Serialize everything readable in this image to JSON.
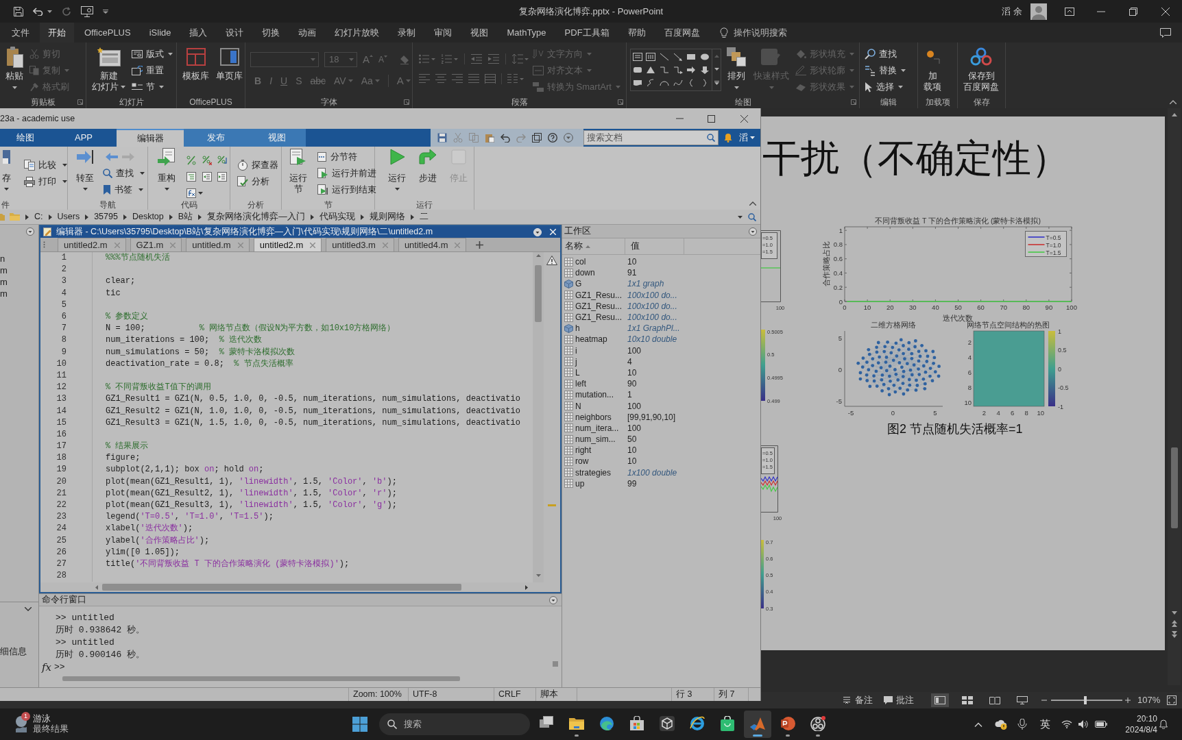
{
  "powerpoint": {
    "title": "复杂网络演化博弈.pptx - PowerPoint",
    "account": "滔 余",
    "menu_tabs": [
      {
        "label": "文件",
        "selected": false
      },
      {
        "label": "开始",
        "selected": true
      },
      {
        "label": "OfficePLUS",
        "selected": false
      },
      {
        "label": "iSlide",
        "selected": false
      },
      {
        "label": "插入",
        "selected": false
      },
      {
        "label": "设计",
        "selected": false
      },
      {
        "label": "切换",
        "selected": false
      },
      {
        "label": "动画",
        "selected": false
      },
      {
        "label": "幻灯片放映",
        "selected": false
      },
      {
        "label": "录制",
        "selected": false
      },
      {
        "label": "审阅",
        "selected": false
      },
      {
        "label": "视图",
        "selected": false
      },
      {
        "label": "MathType",
        "selected": false
      },
      {
        "label": "PDF工具箱",
        "selected": false
      },
      {
        "label": "帮助",
        "selected": false
      },
      {
        "label": "百度网盘",
        "selected": false
      }
    ],
    "tell_me": "操作说明搜索",
    "ribbon_groups": [
      {
        "label": "剪贴板",
        "launcher": true,
        "columns": [
          {
            "kind": "large",
            "lines": [
              "粘贴"
            ],
            "dropdown": true,
            "disabled": false
          },
          {
            "kind": "stack",
            "items": [
              {
                "label": "剪切",
                "dropdown": false,
                "disabled": true
              },
              {
                "label": "复制",
                "dropdown": true,
                "disabled": true
              },
              {
                "label": "格式刷",
                "dropdown": false,
                "disabled": true
              }
            ]
          }
        ]
      },
      {
        "label": "幻灯片",
        "launcher": false,
        "columns": [
          {
            "kind": "large",
            "lines": [
              "新建",
              "幻灯片"
            ],
            "dropdown": true,
            "disabled": false
          },
          {
            "kind": "stack",
            "items": [
              {
                "label": "版式",
                "dropdown": true,
                "disabled": false
              },
              {
                "label": "重置",
                "dropdown": false,
                "disabled": false
              },
              {
                "label": "节",
                "dropdown": true,
                "disabled": false
              }
            ]
          }
        ]
      },
      {
        "label": "OfficePLUS",
        "launcher": false,
        "columns": [
          {
            "kind": "large",
            "lines": [
              "模板库"
            ],
            "dropdown": false,
            "disabled": false
          },
          {
            "kind": "large",
            "lines": [
              "单页库"
            ],
            "dropdown": false,
            "disabled": false
          }
        ]
      },
      {
        "label": "字体",
        "launcher": true,
        "columns": [
          {
            "kind": "font",
            "size": "18",
            "grow": "A",
            "shrink": "A",
            "styles": [
              "B",
              "I",
              "U",
              "S",
              "abc",
              "AV",
              "Aa"
            ],
            "color_button": "A",
            "disabled": true
          }
        ]
      },
      {
        "label": "段落",
        "launcher": true,
        "columns": [
          {
            "kind": "paragraph",
            "disabled": true
          },
          {
            "kind": "stack",
            "items": [
              {
                "label": "文字方向",
                "dropdown": true,
                "disabled": true
              },
              {
                "label": "对齐文本",
                "dropdown": true,
                "disabled": true
              },
              {
                "label": "转换为 SmartArt",
                "dropdown": true,
                "disabled": true
              }
            ]
          }
        ]
      },
      {
        "label": "绘图",
        "launcher": true,
        "columns": [
          {
            "kind": "gallery"
          },
          {
            "kind": "large",
            "lines": [
              "排列"
            ],
            "dropdown": true,
            "disabled": false
          },
          {
            "kind": "large",
            "lines": [
              "快速样式"
            ],
            "dropdown": true,
            "disabled": true
          },
          {
            "kind": "stack",
            "items": [
              {
                "label": "形状填充",
                "dropdown": true,
                "disabled": true
              },
              {
                "label": "形状轮廓",
                "dropdown": true,
                "disabled": true
              },
              {
                "label": "形状效果",
                "dropdown": true,
                "disabled": true
              }
            ]
          }
        ]
      },
      {
        "label": "编辑",
        "launcher": false,
        "columns": [
          {
            "kind": "stack",
            "items": [
              {
                "label": "查找",
                "dropdown": false,
                "disabled": false
              },
              {
                "label": "替换",
                "dropdown": true,
                "disabled": false
              },
              {
                "label": "选择",
                "dropdown": true,
                "disabled": false
              }
            ]
          }
        ]
      },
      {
        "label": "加载项",
        "launcher": false,
        "columns": [
          {
            "kind": "large",
            "lines": [
              "加",
              "载项"
            ],
            "dropdown": false,
            "disabled": false
          }
        ]
      },
      {
        "label": "保存",
        "launcher": false,
        "columns": [
          {
            "kind": "large",
            "lines": [
              "保存到",
              "百度网盘"
            ],
            "dropdown": false,
            "disabled": false
          }
        ]
      }
    ],
    "slide": {
      "title": "干扰（不确定性）",
      "partial_figures": [
        {
          "kind": "flatplot",
          "legend": [
            "=0.5",
            "=1.0",
            "=1.5"
          ],
          "x_tick": "100"
        },
        {
          "kind": "colorbar",
          "ticks": [
            "0.5005",
            "0.5",
            "0.4995",
            "0.499"
          ]
        },
        {
          "kind": "wavyplot",
          "legend": [
            "=0.5",
            "=1.0",
            "=1.5"
          ],
          "x_tick": "100"
        },
        {
          "kind": "colorbar",
          "ticks": [
            "0.7",
            "0.6",
            "0.5",
            "0.4",
            "0.3"
          ]
        }
      ],
      "line_chart": {
        "chart_data": {
          "type": "line",
          "title": "不同背叛收益 T 下的合作策略演化 (蒙特卡洛模拟)",
          "xlabel": "迭代次数",
          "ylabel": "合作策略占比",
          "x": [
            1,
            100
          ],
          "series": [
            {
              "name": "T=0.5",
              "color": "#3232c8",
              "values": [
                null,
                null
              ]
            },
            {
              "name": "T=1.0",
              "color": "#c83232",
              "values": [
                null,
                null
              ]
            },
            {
              "name": "T=1.5",
              "color": "#46c846",
              "values": [
                0,
                0
              ]
            }
          ],
          "xlim": [
            0,
            100
          ],
          "ylim": [
            0,
            1.05
          ],
          "xticks": [
            0,
            10,
            20,
            30,
            40,
            50,
            60,
            70,
            80,
            90,
            100
          ],
          "yticks": [
            0,
            0.2,
            0.4,
            0.6,
            0.8,
            1
          ],
          "legend": "upper right"
        }
      },
      "network_plot": {
        "title": "二维方格网络",
        "yticks": [
          "5",
          "0",
          "-5"
        ],
        "xticks": [
          "-5",
          "0",
          "5"
        ]
      },
      "heatmap": {
        "title": "网络节点空间结构的热图",
        "yticks": [
          "2",
          "4",
          "6",
          "8",
          "10"
        ],
        "xticks": [
          "2",
          "4",
          "6",
          "8",
          "10"
        ],
        "colorbar_ticks": [
          "1",
          "0.5",
          "0",
          "-0.5",
          "-1"
        ]
      },
      "caption": "图2 节点随机失活概率=1"
    },
    "status_bar": {
      "notes": "备注",
      "comments": "批注",
      "views": [
        {
          "selected": true
        },
        {
          "selected": false
        },
        {
          "selected": false
        },
        {
          "selected": false
        }
      ],
      "zoom": {
        "level": 0.48,
        "reading": "107%"
      }
    }
  },
  "matlab": {
    "title": "23a - academic use",
    "tabs": [
      {
        "label": "绘图",
        "selected": false,
        "contextual": false
      },
      {
        "label": "APP",
        "selected": false,
        "contextual": false
      },
      {
        "label": "编辑器",
        "selected": true,
        "contextual": true
      },
      {
        "label": "发布",
        "selected": false,
        "contextual": true
      },
      {
        "label": "视图",
        "selected": false,
        "contextual": true
      }
    ],
    "search": {
      "placeholder": "搜索文档"
    },
    "account": "滔",
    "toolstrip": [
      {
        "label": "件",
        "columns": [
          {
            "kind": "large",
            "lines": [
              "存"
            ],
            "dropdown": true,
            "disabled": false
          },
          {
            "kind": "stack",
            "items": [
              {
                "kind": "button",
                "label": "比较",
                "dropdown": true,
                "disabled": false
              },
              {
                "kind": "button",
                "label": "打印",
                "dropdown": true,
                "disabled": false
              }
            ]
          }
        ]
      },
      {
        "label": "导航",
        "columns": [
          {
            "kind": "large",
            "lines": [
              "转至"
            ],
            "dropdown": true,
            "disabled": false
          },
          {
            "kind": "stack",
            "items": [
              {
                "kind": "arrows",
                "back_disabled": false,
                "forward_disabled": true
              },
              {
                "kind": "button",
                "label": "查找",
                "dropdown": true,
                "disabled": false
              },
              {
                "kind": "button",
                "label": "书签",
                "dropdown": true,
                "disabled": false
              }
            ]
          }
        ]
      },
      {
        "label": "代码",
        "columns": [
          {
            "kind": "large",
            "lines": [
              "重构"
            ],
            "dropdown": true,
            "disabled": false
          },
          {
            "kind": "icon_grid"
          }
        ]
      },
      {
        "label": "分析",
        "columns": [
          {
            "kind": "stack",
            "items": [
              {
                "kind": "button",
                "label": "探查器",
                "dropdown": false,
                "disabled": false
              },
              {
                "kind": "button",
                "label": "分析",
                "dropdown": false,
                "disabled": false
              }
            ]
          }
        ]
      },
      {
        "label": "节",
        "columns": [
          {
            "kind": "large",
            "lines": [
              "运行",
              "节"
            ],
            "dropdown": false,
            "disabled": false
          },
          {
            "kind": "stack",
            "items": [
              {
                "kind": "button",
                "label": "分节符",
                "dropdown": false,
                "disabled": false
              },
              {
                "kind": "button",
                "label": "运行并前进",
                "dropdown": false,
                "disabled": false
              },
              {
                "kind": "button",
                "label": "运行到结束",
                "dropdown": false,
                "disabled": false
              }
            ]
          }
        ]
      },
      {
        "label": "运行",
        "columns": [
          {
            "kind": "large",
            "lines": [
              "运行"
            ],
            "dropdown": true,
            "disabled": false
          },
          {
            "kind": "large",
            "lines": [
              "步进"
            ],
            "dropdown": false,
            "disabled": false
          },
          {
            "kind": "large",
            "lines": [
              "停止"
            ],
            "dropdown": false,
            "disabled": true
          }
        ]
      }
    ],
    "path": [
      "C:",
      "Users",
      "35795",
      "Desktop",
      "B站",
      "复杂网络演化博弈—入门",
      "代码实现",
      "规则网络",
      "二"
    ],
    "file_browser": {
      "items": [
        "n",
        "m",
        "m",
        "m"
      ],
      "details": "细信息"
    },
    "editor": {
      "title": "编辑器 - C:\\Users\\35795\\Desktop\\B站\\复杂网络演化博弈—入门\\代码实现\\规则网络\\二\\untitled2.m",
      "tabs": [
        {
          "label": "untitled2.m",
          "selected": false
        },
        {
          "label": "GZ1.m",
          "selected": false
        },
        {
          "label": "untitled.m",
          "selected": false
        },
        {
          "label": "untitled2.m",
          "selected": true
        },
        {
          "label": "untitled3.m",
          "selected": false
        },
        {
          "label": "untitled4.m",
          "selected": false
        }
      ],
      "lines": [
        {
          "number": "1",
          "segments": [
            {
              "kind": "comment",
              "text": "%%%节点随机失活"
            }
          ]
        },
        {
          "number": "2"
        },
        {
          "number": "3",
          "segments": [
            {
              "kind": "code",
              "text": "clear;"
            }
          ]
        },
        {
          "number": "4",
          "segments": [
            {
              "kind": "code",
              "text": "tic"
            }
          ]
        },
        {
          "number": "5"
        },
        {
          "number": "6",
          "segments": [
            {
              "kind": "comment",
              "text": "% 参数定义"
            }
          ]
        },
        {
          "number": "7",
          "segments": [
            {
              "kind": "code",
              "text": "N = 100;           "
            },
            {
              "kind": "comment",
              "text": "% 网络节点数（假设N为平方数，如10x10方格网络）"
            }
          ]
        },
        {
          "number": "8",
          "segments": [
            {
              "kind": "code",
              "text": "num_iterations = 100;  "
            },
            {
              "kind": "comment",
              "text": "% 迭代次数"
            }
          ]
        },
        {
          "number": "9",
          "segments": [
            {
              "kind": "code",
              "text": "num_simulations = 50;  "
            },
            {
              "kind": "comment",
              "text": "% 蒙特卡洛模拟次数"
            }
          ]
        },
        {
          "number": "10",
          "segments": [
            {
              "kind": "code",
              "text": "deactivation_rate = 0.8;  "
            },
            {
              "kind": "comment",
              "text": "% 节点失活概率"
            }
          ]
        },
        {
          "number": "11"
        },
        {
          "number": "12",
          "segments": [
            {
              "kind": "comment",
              "text": "% 不同背叛收益T值下的调用"
            }
          ]
        },
        {
          "number": "13",
          "segments": [
            {
              "kind": "code",
              "text": "GZ1_Result1 = GZ1(N, 0.5, 1.0, 0, -0.5, num_iterations, num_simulations, deactivatio"
            }
          ]
        },
        {
          "number": "14",
          "segments": [
            {
              "kind": "code",
              "text": "GZ1_Result2 = GZ1(N, 1.0, 1.0, 0, -0.5, num_iterations, num_simulations, deactivatio"
            }
          ]
        },
        {
          "number": "15",
          "segments": [
            {
              "kind": "code",
              "text": "GZ1_Result3 = GZ1(N, 1.5, 1.0, 0, -0.5, num_iterations, num_simulations, deactivatio"
            }
          ]
        },
        {
          "number": "16"
        },
        {
          "number": "17",
          "segments": [
            {
              "kind": "comment",
              "text": "% 结果展示"
            }
          ]
        },
        {
          "number": "18",
          "segments": [
            {
              "kind": "code",
              "text": "figure;"
            }
          ]
        },
        {
          "number": "19",
          "segments": [
            {
              "kind": "code",
              "text": "subplot(2,1,1); box "
            },
            {
              "kind": "string",
              "text": "on"
            },
            {
              "kind": "code",
              "text": "; hold "
            },
            {
              "kind": "string",
              "text": "on"
            },
            {
              "kind": "code",
              "text": ";"
            }
          ]
        },
        {
          "number": "20",
          "segments": [
            {
              "kind": "code",
              "text": "plot(mean(GZ1_Result1, 1), "
            },
            {
              "kind": "string",
              "text": "'linewidth'"
            },
            {
              "kind": "code",
              "text": ", 1.5, "
            },
            {
              "kind": "string",
              "text": "'Color'"
            },
            {
              "kind": "code",
              "text": ", "
            },
            {
              "kind": "string",
              "text": "'b'"
            },
            {
              "kind": "code",
              "text": ");"
            }
          ]
        },
        {
          "number": "21",
          "segments": [
            {
              "kind": "code",
              "text": "plot(mean(GZ1_Result2, 1), "
            },
            {
              "kind": "string",
              "text": "'linewidth'"
            },
            {
              "kind": "code",
              "text": ", 1.5, "
            },
            {
              "kind": "string",
              "text": "'Color'"
            },
            {
              "kind": "code",
              "text": ", "
            },
            {
              "kind": "string",
              "text": "'r'"
            },
            {
              "kind": "code",
              "text": ");"
            }
          ]
        },
        {
          "number": "22",
          "segments": [
            {
              "kind": "code",
              "text": "plot(mean(GZ1_Result3, 1), "
            },
            {
              "kind": "string",
              "text": "'linewidth'"
            },
            {
              "kind": "code",
              "text": ", 1.5, "
            },
            {
              "kind": "string",
              "text": "'Color'"
            },
            {
              "kind": "code",
              "text": ", "
            },
            {
              "kind": "string",
              "text": "'g'"
            },
            {
              "kind": "code",
              "text": ");"
            }
          ]
        },
        {
          "number": "23",
          "segments": [
            {
              "kind": "code",
              "text": "legend("
            },
            {
              "kind": "string",
              "text": "'T=0.5'"
            },
            {
              "kind": "code",
              "text": ", "
            },
            {
              "kind": "string",
              "text": "'T=1.0'"
            },
            {
              "kind": "code",
              "text": ", "
            },
            {
              "kind": "string",
              "text": "'T=1.5'"
            },
            {
              "kind": "code",
              "text": ");"
            }
          ]
        },
        {
          "number": "24",
          "segments": [
            {
              "kind": "code",
              "text": "xlabel("
            },
            {
              "kind": "string",
              "text": "'迭代次数'"
            },
            {
              "kind": "code",
              "text": ");"
            }
          ]
        },
        {
          "number": "25",
          "segments": [
            {
              "kind": "code",
              "text": "ylabel("
            },
            {
              "kind": "string",
              "text": "'合作策略占比'"
            },
            {
              "kind": "code",
              "text": ");"
            }
          ]
        },
        {
          "number": "26",
          "segments": [
            {
              "kind": "code",
              "text": "ylim([0 1.05]);"
            }
          ]
        },
        {
          "number": "27",
          "segments": [
            {
              "kind": "code",
              "text": "title("
            },
            {
              "kind": "string",
              "text": "'不同背叛收益 T 下的合作策略演化 (蒙特卡洛模拟)'"
            },
            {
              "kind": "code",
              "text": ");"
            }
          ]
        },
        {
          "number": "28"
        }
      ]
    },
    "command_window": {
      "title": "命令行窗口",
      "lines": [
        ">> untitled",
        "历时 0.938642 秒。",
        ">> untitled",
        "历时 0.900146 秒。"
      ],
      "prompt": {
        "icon": "fx",
        "text": ">>"
      }
    },
    "workspace": {
      "title": "工作区",
      "columns": [
        "名称",
        "值"
      ],
      "rows": [
        {
          "name": "col",
          "value": "10",
          "kind": "value"
        },
        {
          "name": "down",
          "value": "91",
          "kind": "value"
        },
        {
          "name": "G",
          "value": "1x1 graph",
          "kind": "object"
        },
        {
          "name": "GZ1_Resu...",
          "value": "100x100 do...",
          "kind": "summary"
        },
        {
          "name": "GZ1_Resu...",
          "value": "100x100 do...",
          "kind": "summary"
        },
        {
          "name": "GZ1_Resu...",
          "value": "100x100 do...",
          "kind": "summary"
        },
        {
          "name": "h",
          "value": "1x1 GraphPl...",
          "kind": "object"
        },
        {
          "name": "heatmap",
          "value": "10x10 double",
          "kind": "summary"
        },
        {
          "name": "i",
          "value": "100",
          "kind": "value"
        },
        {
          "name": "j",
          "value": "4",
          "kind": "value"
        },
        {
          "name": "L",
          "value": "10",
          "kind": "value"
        },
        {
          "name": "left",
          "value": "90",
          "kind": "value"
        },
        {
          "name": "mutation...",
          "value": "1",
          "kind": "value"
        },
        {
          "name": "N",
          "value": "100",
          "kind": "value"
        },
        {
          "name": "neighbors",
          "value": "[99,91,90,10]",
          "kind": "value"
        },
        {
          "name": "num_itera...",
          "value": "100",
          "kind": "value"
        },
        {
          "name": "num_sim...",
          "value": "50",
          "kind": "value"
        },
        {
          "name": "right",
          "value": "10",
          "kind": "value"
        },
        {
          "name": "row",
          "value": "10",
          "kind": "value"
        },
        {
          "name": "strategies",
          "value": "1x100 double",
          "kind": "summary"
        },
        {
          "name": "up",
          "value": "99",
          "kind": "value"
        }
      ]
    },
    "status_bar": {
      "zoom": "Zoom: 100%",
      "encoding": "UTF-8",
      "line_ending": "CRLF",
      "file_type": "脚本",
      "row": "行 3",
      "column": "列 7"
    }
  },
  "taskbar": {
    "widget": {
      "badge": "1",
      "title": "游泳",
      "subtitle": "最终结果"
    },
    "search": {
      "placeholder": "搜索"
    },
    "apps": [
      {
        "running": false,
        "active": false
      },
      {
        "running": true,
        "active": false
      },
      {
        "running": false,
        "active": false
      },
      {
        "running": false,
        "active": false
      },
      {
        "running": false,
        "active": false
      },
      {
        "running": false,
        "active": false
      },
      {
        "running": false,
        "active": false
      },
      {
        "running": true,
        "active": true
      },
      {
        "running": true,
        "active": false
      },
      {
        "running": true,
        "active": false
      }
    ],
    "tray": {
      "input_method": "英",
      "time": "20:10",
      "date": "2024/8/4"
    }
  }
}
